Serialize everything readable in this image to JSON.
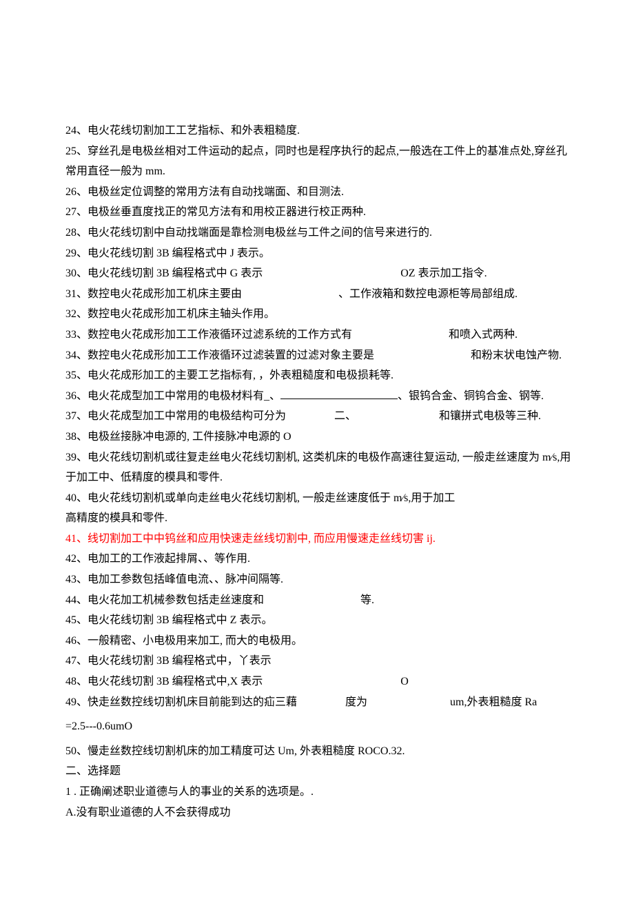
{
  "lines": {
    "l24": "24、电火花线切割加工工艺指标、和外表粗糙度.",
    "l25": "25、穿丝孔是电极丝相对工件运动的起点，同时也是程序执行的起点,一般选在工件上的基准点处,穿丝孔常用直径一般为 mm.",
    "l26": "26、电极丝定位调整的常用方法有自动找端面、和目测法.",
    "l27": "27、电极丝垂直度找正的常见方法有和用校正器进行校正两种.",
    "l28": "28、电火花线切割中自动找端面是靠检测电极丝与工件之间的信号来进行的.",
    "l29": "29、电火花线切割 3B 编程格式中 J 表示。",
    "l30a": "30、电火花线切割 3B 编程格式中 G 表示",
    "l30b": "OZ 表示加工指令.",
    "l31a": "31、数控电火花成形加工机床主要由",
    "l31b": "、工作液箱和数控电源柜等局部组成.",
    "l32": "32、数控电火花成形加工机床主轴头作用。",
    "l33a": "33、数控电火花成形加工工作液循环过滤系统的工作方式有",
    "l33b": "和喷入式两种.",
    "l34a": "34、数控电火花成形加工工作液循环过滤装置的过滤对象主要是",
    "l34b": "和粉末状电蚀产物.",
    "l35": "35、电火花成形加工的主要工艺指标有, ，外表粗糙度和电极损耗等.",
    "l36a": "36、电火花成型加工中常用的电极材料有_、",
    "l36b": "、银钨合金、铜钨合金、钢等.",
    "l37a": "37、电火花成型加工中常用的电极结构可分为",
    "l37b": "二、",
    "l37c": "和镶拼式电极等三种.",
    "l38": "38、电极丝接脉冲电源的, 工件接脉冲电源的 O",
    "l39": "39、电火花线切割机或往复走丝电火花线切割机, 这类机床的电极作高速往复运动, 一般走丝速度为 m⁄s,用于加工中、低精度的模具和零件.",
    "l40": "40、电火花线切割机或单向走丝电火花线切割机, 一般走丝速度低于 m⁄s,用于加工",
    "l40b": "高精度的模具和零件.",
    "l41": "41、线切割加工中中钨丝和应用快速走丝线切割中, 而应用慢速走丝线切害 ij.",
    "l42": "42、电加工的工作液起排屑、、等作用.",
    "l43": "43、电加工参数包括峰值电流、、脉冲间隔等.",
    "l44a": "44、电火花加工机械参数包括走丝速度和",
    "l44b": "等.",
    "l45": "45、电火花线切割 3B 编程格式中 Z 表示。",
    "l46": "46、一般精密、小电极用来加工, 而大的电极用。",
    "l47": "47、电火花线切割 3B 编程格式中，丫表示",
    "l48a": "48、电火花线切割 3B 编程格式中,X 表示",
    "l48b": "O",
    "l49a": "49、快走丝数控线切割机床目前能到达的疝三藉",
    "l49b": "度为",
    "l49c": "um,外表粗糙度 Ra",
    "l49d": "=2.5---0.6umO",
    "l50": "50、慢走丝数控线切割机床的加工精度可达 Um, 外表粗糙度 ROCO.32.",
    "sec2": "二、选择题",
    "q1": "1 . 正确阐述职业道德与人的事业的关系的选项是。.",
    "q1a": "A.没有职业道德的人不会获得成功"
  }
}
